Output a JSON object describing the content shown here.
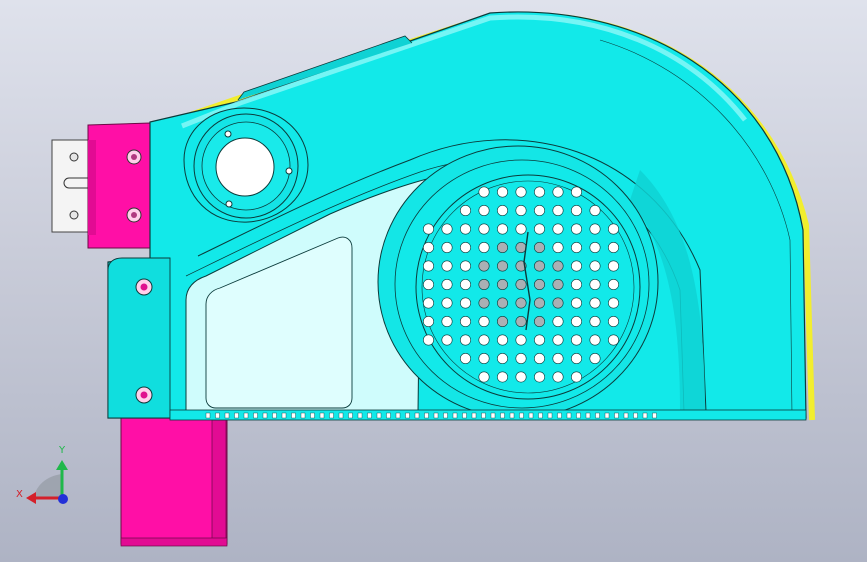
{
  "viewport": {
    "background_top": "#dfe2ec",
    "background_bottom": "#aeb3c4"
  },
  "colors": {
    "housing": "#12e9e9",
    "housing_dark": "#0fd2d4",
    "housing_light": "#8ff7f7",
    "panel": "#cffcfc",
    "mount": "#ff0fa6",
    "bracket": "#f4f4f4",
    "trim": "#f2ee2e",
    "hole": "#ffffff",
    "hole_shaded": "#aab0b4",
    "edge": "#0b3b3b"
  },
  "model": {
    "components": [
      "fan-housing",
      "mounting-block-upper",
      "mounting-block-lower",
      "mounting-bracket",
      "inlet-grille",
      "bearing-cap"
    ],
    "grille_rows": [
      {
        "cols": [
          0,
          1,
          2,
          3,
          4,
          5
        ],
        "shaded": []
      },
      {
        "cols": [
          -1,
          0,
          1,
          2,
          3,
          4,
          5,
          6
        ],
        "shaded": []
      },
      {
        "cols": [
          -3,
          -2,
          -1,
          0,
          1,
          2,
          3,
          4,
          5,
          6,
          7
        ],
        "shaded": []
      },
      {
        "cols": [
          -3,
          -2,
          -1,
          0,
          1,
          2,
          3,
          4,
          5,
          6,
          7
        ],
        "shaded": [
          1,
          2,
          3
        ]
      },
      {
        "cols": [
          -3,
          -2,
          -1,
          0,
          1,
          2,
          3,
          4,
          5,
          6,
          7
        ],
        "shaded": [
          0,
          1,
          2,
          3,
          4
        ]
      },
      {
        "cols": [
          -3,
          -2,
          -1,
          0,
          1,
          2,
          3,
          4,
          5,
          6,
          7
        ],
        "shaded": [
          0,
          1,
          2,
          3,
          4
        ]
      },
      {
        "cols": [
          -3,
          -2,
          -1,
          0,
          1,
          2,
          3,
          4,
          5,
          6,
          7
        ],
        "shaded": [
          0,
          1,
          2,
          3,
          4
        ]
      },
      {
        "cols": [
          -3,
          -2,
          -1,
          0,
          1,
          2,
          3,
          4,
          5,
          6,
          7
        ],
        "shaded": [
          1,
          2,
          3
        ]
      },
      {
        "cols": [
          -3,
          -2,
          -1,
          0,
          1,
          2,
          3,
          4,
          5,
          6,
          7
        ],
        "shaded": []
      },
      {
        "cols": [
          -1,
          0,
          1,
          2,
          3,
          4,
          5,
          6
        ],
        "shaded": []
      },
      {
        "cols": [
          0,
          1,
          2,
          3,
          4,
          5
        ],
        "shaded": []
      }
    ]
  },
  "triad": {
    "x_label": "X",
    "y_label": "Y",
    "x_color": "#d4202a",
    "y_color": "#1fb84a",
    "z_color": "#2330d8"
  }
}
